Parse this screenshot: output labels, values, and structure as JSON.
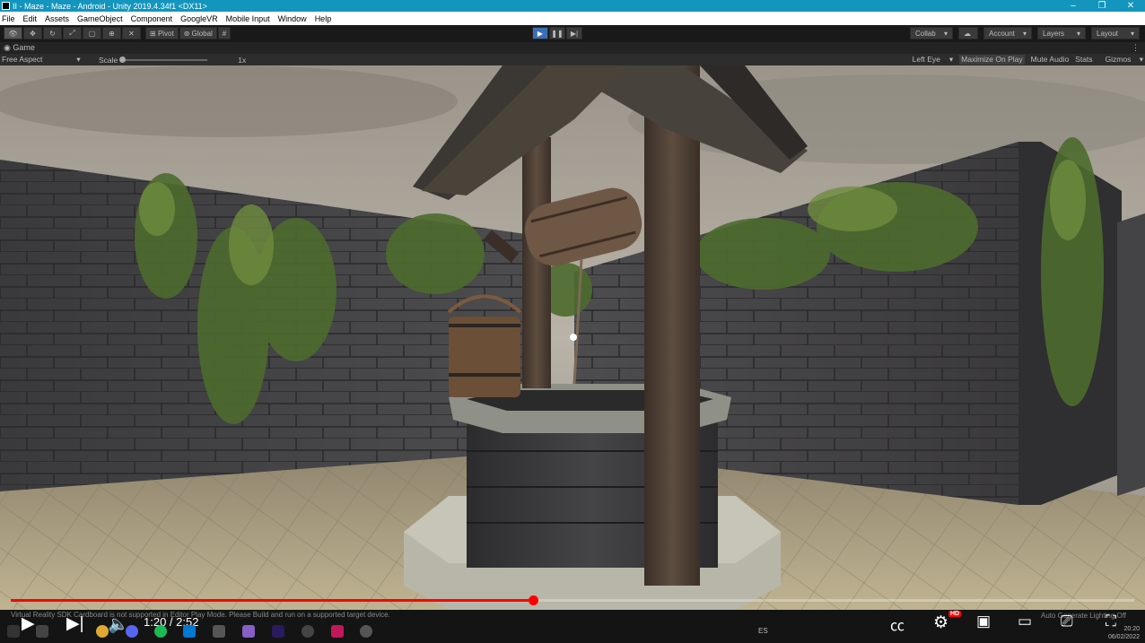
{
  "window": {
    "title": "II - Maze - Maze - Android - Unity 2019.4.34f1 <DX11>"
  },
  "menu": [
    "File",
    "Edit",
    "Assets",
    "GameObject",
    "Component",
    "GoogleVR",
    "Mobile Input",
    "Window",
    "Help"
  ],
  "toolbar": {
    "pivot_label": "Pivot",
    "global_label": "Global",
    "collab_label": "Collab",
    "account_label": "Account",
    "layers_label": "Layers",
    "layout_label": "Layout"
  },
  "game": {
    "tab_label": "Game",
    "aspect": "Free Aspect",
    "scale_label": "Scale",
    "scale_value": "1x",
    "eye": "Left Eye",
    "maximize": "Maximize On Play",
    "mute": "Mute Audio",
    "stats": "Stats",
    "gizmos": "Gizmos"
  },
  "console": {
    "status": "Virtual Reality SDK Cardboard is not supported in Editor Play Mode. Please Build and run on a supported target device."
  },
  "video": {
    "time": "1:20 / 2:52",
    "progress_fraction": 0.465,
    "hd_badge": "HD",
    "auto_text": "Auto Generate Lighting Off"
  },
  "taskbar": {
    "lang": "ES",
    "date": "06/02/2022",
    "clock": "20:20"
  },
  "colors": {
    "titlebar": "#1395bd",
    "play_active": "#3b6fb5",
    "progress": "#ff0000"
  }
}
